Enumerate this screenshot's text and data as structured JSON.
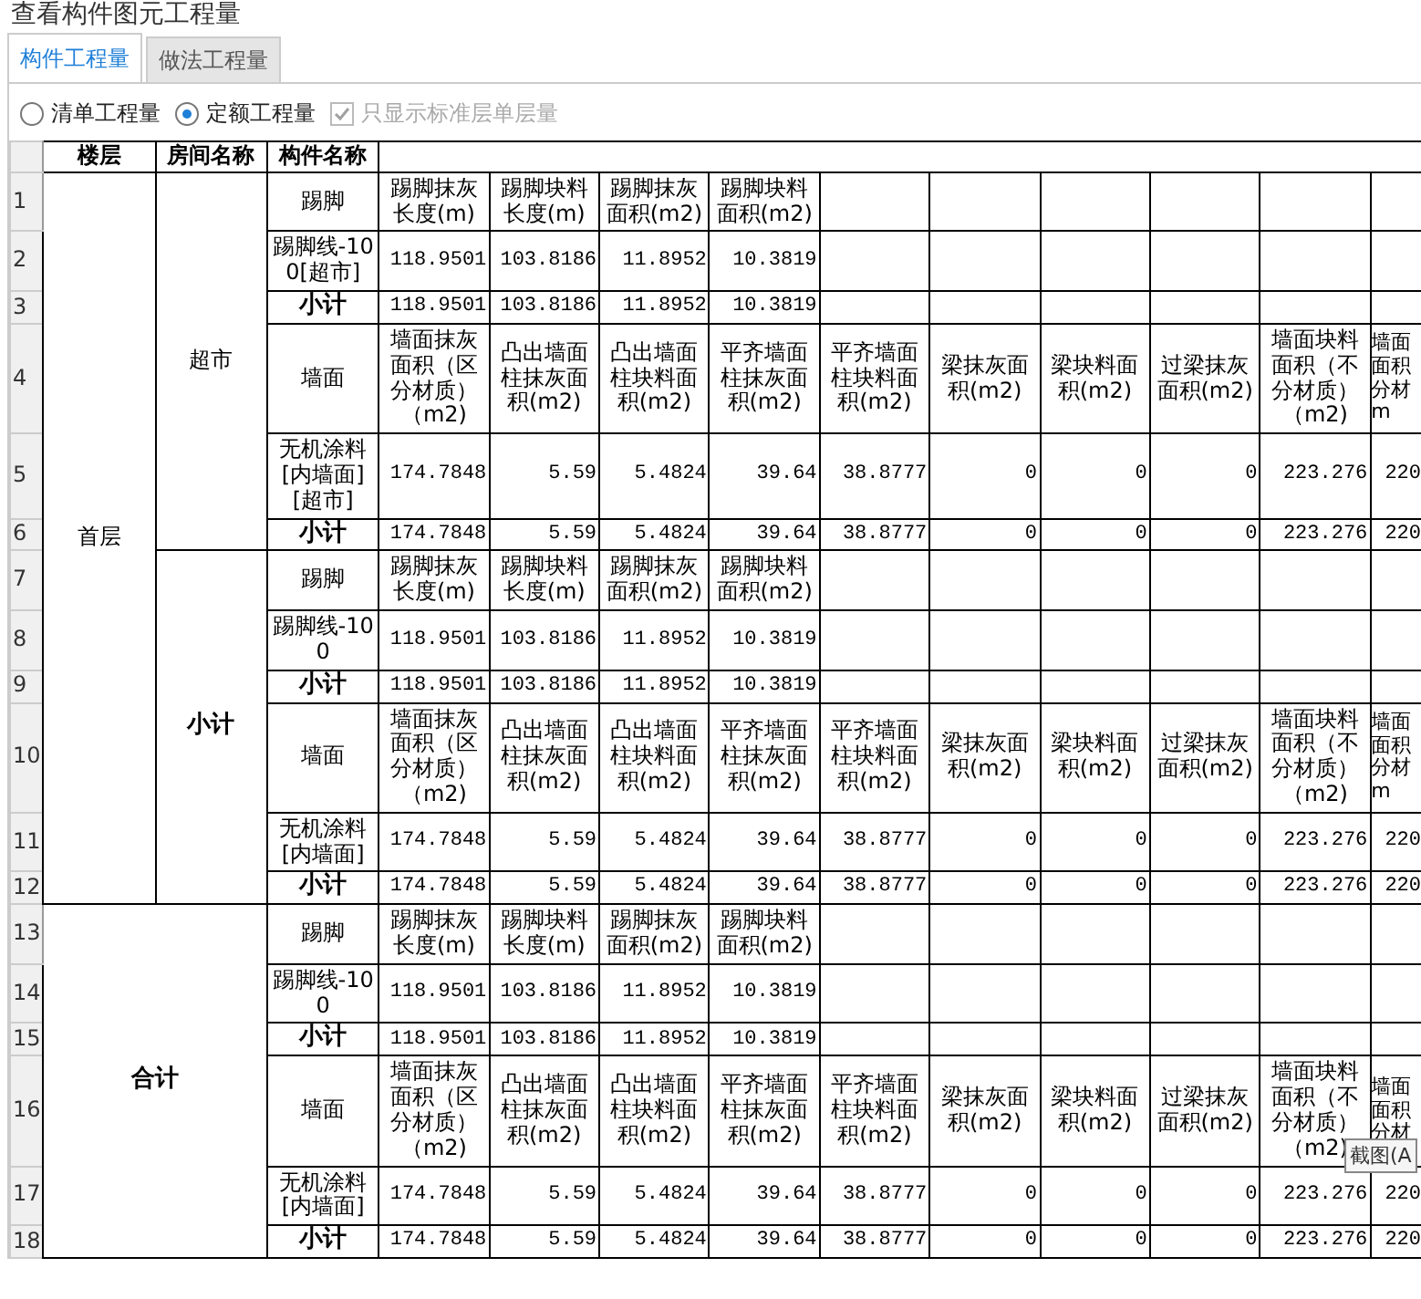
{
  "window": {
    "title": "查看构件图元工程量"
  },
  "tabs": [
    {
      "label": "构件工程量",
      "selected": true
    },
    {
      "label": "做法工程量",
      "selected": false
    }
  ],
  "options": [
    {
      "kind": "radio",
      "label": "清单工程量",
      "selected": false
    },
    {
      "kind": "radio",
      "label": "定额工程量",
      "selected": true
    },
    {
      "kind": "checkbox",
      "label": "只显示标准层单层量",
      "checked": true,
      "disabled": true
    }
  ],
  "table": {
    "columns": [
      "楼层",
      "房间名称",
      "构件名称"
    ],
    "sections": [
      {
        "floor": "首层",
        "kind": "floor",
        "rooms": [
          {
            "name": "超市",
            "kind": "room",
            "components": [
              {
                "name": "踢脚",
                "num": "1",
                "headers": [
                  "踢脚抹灰长度(m)",
                  "踢脚块料长度(m)",
                  "踢脚抹灰面积(m2)",
                  "踢脚块料面积(m2)"
                ],
                "rows": [
                  {
                    "num": "2",
                    "kind": "item",
                    "name": "踢脚线-100[超市]",
                    "values": [
                      "118.9501",
                      "103.8186",
                      "11.8952",
                      "10.3819"
                    ]
                  },
                  {
                    "num": "3",
                    "kind": "subtotal",
                    "name": "小计",
                    "values": [
                      "118.9501",
                      "103.8186",
                      "11.8952",
                      "10.3819"
                    ]
                  }
                ]
              },
              {
                "name": "墙面",
                "num": "4",
                "headers": [
                  "墙面抹灰面积（区分材质）（m2)",
                  "凸出墙面柱抹灰面积(m2)",
                  "凸出墙面柱块料面积(m2)",
                  "平齐墙面柱抹灰面积(m2)",
                  "平齐墙面柱块料面积(m2)",
                  "梁抹灰面积(m2)",
                  "梁块料面积(m2)",
                  "过梁抹灰面积(m2)",
                  "墙面块料面积（不分材质）（m2)",
                  "墙面面积分材m"
                ],
                "rows": [
                  {
                    "num": "5",
                    "kind": "item",
                    "name": "无机涂料[内墙面][超市]",
                    "values": [
                      "174.7848",
                      "5.59",
                      "5.4824",
                      "39.64",
                      "38.8777",
                      "0",
                      "0",
                      "0",
                      "223.276",
                      "220"
                    ]
                  },
                  {
                    "num": "6",
                    "kind": "subtotal",
                    "name": "小计",
                    "values": [
                      "174.7848",
                      "5.59",
                      "5.4824",
                      "39.64",
                      "38.8777",
                      "0",
                      "0",
                      "0",
                      "223.276",
                      "220"
                    ]
                  }
                ]
              }
            ]
          },
          {
            "name": "小计",
            "kind": "subtotal",
            "components": [
              {
                "name": "踢脚",
                "num": "7",
                "headers": [
                  "踢脚抹灰长度(m)",
                  "踢脚块料长度(m)",
                  "踢脚抹灰面积(m2)",
                  "踢脚块料面积(m2)"
                ],
                "rows": [
                  {
                    "num": "8",
                    "kind": "item",
                    "name": "踢脚线-100",
                    "values": [
                      "118.9501",
                      "103.8186",
                      "11.8952",
                      "10.3819"
                    ]
                  },
                  {
                    "num": "9",
                    "kind": "subtotal",
                    "name": "小计",
                    "values": [
                      "118.9501",
                      "103.8186",
                      "11.8952",
                      "10.3819"
                    ]
                  }
                ]
              },
              {
                "name": "墙面",
                "num": "10",
                "headers": [
                  "墙面抹灰面积（区分材质）（m2)",
                  "凸出墙面柱抹灰面积(m2)",
                  "凸出墙面柱块料面积(m2)",
                  "平齐墙面柱抹灰面积(m2)",
                  "平齐墙面柱块料面积(m2)",
                  "梁抹灰面积(m2)",
                  "梁块料面积(m2)",
                  "过梁抹灰面积(m2)",
                  "墙面块料面积（不分材质）（m2)",
                  "墙面面积分材m"
                ],
                "rows": [
                  {
                    "num": "11",
                    "kind": "item",
                    "name": "无机涂料[内墙面]",
                    "values": [
                      "174.7848",
                      "5.59",
                      "5.4824",
                      "39.64",
                      "38.8777",
                      "0",
                      "0",
                      "0",
                      "223.276",
                      "220"
                    ]
                  },
                  {
                    "num": "12",
                    "kind": "subtotal",
                    "name": "小计",
                    "values": [
                      "174.7848",
                      "5.59",
                      "5.4824",
                      "39.64",
                      "38.8777",
                      "0",
                      "0",
                      "0",
                      "223.276",
                      "220"
                    ]
                  }
                ]
              }
            ]
          }
        ]
      },
      {
        "floor": "合计",
        "kind": "total",
        "components": [
          {
            "name": "踢脚",
            "num": "13",
            "headers": [
              "踢脚抹灰长度(m)",
              "踢脚块料长度(m)",
              "踢脚抹灰面积(m2)",
              "踢脚块料面积(m2)"
            ],
            "rows": [
              {
                "num": "14",
                "kind": "item",
                "name": "踢脚线-100",
                "values": [
                  "118.9501",
                  "103.8186",
                  "11.8952",
                  "10.3819"
                ]
              },
              {
                "num": "15",
                "kind": "subtotal",
                "name": "小计",
                "values": [
                  "118.9501",
                  "103.8186",
                  "11.8952",
                  "10.3819"
                ]
              }
            ]
          },
          {
            "name": "墙面",
            "num": "16",
            "headers": [
              "墙面抹灰面积（区分材质）（m2)",
              "凸出墙面柱抹灰面积(m2)",
              "凸出墙面柱块料面积(m2)",
              "平齐墙面柱抹灰面积(m2)",
              "平齐墙面柱块料面积(m2)",
              "梁抹灰面积(m2)",
              "梁块料面积(m2)",
              "过梁抹灰面积(m2)",
              "墙面块料面积（不分材质）（m2)",
              "墙面面积分材"
            ],
            "rows": [
              {
                "num": "17",
                "kind": "item",
                "name": "无机涂料[内墙面]",
                "values": [
                  "174.7848",
                  "5.59",
                  "5.4824",
                  "39.64",
                  "38.8777",
                  "0",
                  "0",
                  "0",
                  "223.276",
                  "220"
                ]
              },
              {
                "num": "18",
                "kind": "subtotal",
                "name": "小计",
                "values": [
                  "174.7848",
                  "5.59",
                  "5.4824",
                  "39.64",
                  "38.8777",
                  "0",
                  "0",
                  "0",
                  "223.276",
                  "220"
                ]
              }
            ]
          }
        ]
      }
    ]
  },
  "tooltip": {
    "text": "截图(A"
  }
}
